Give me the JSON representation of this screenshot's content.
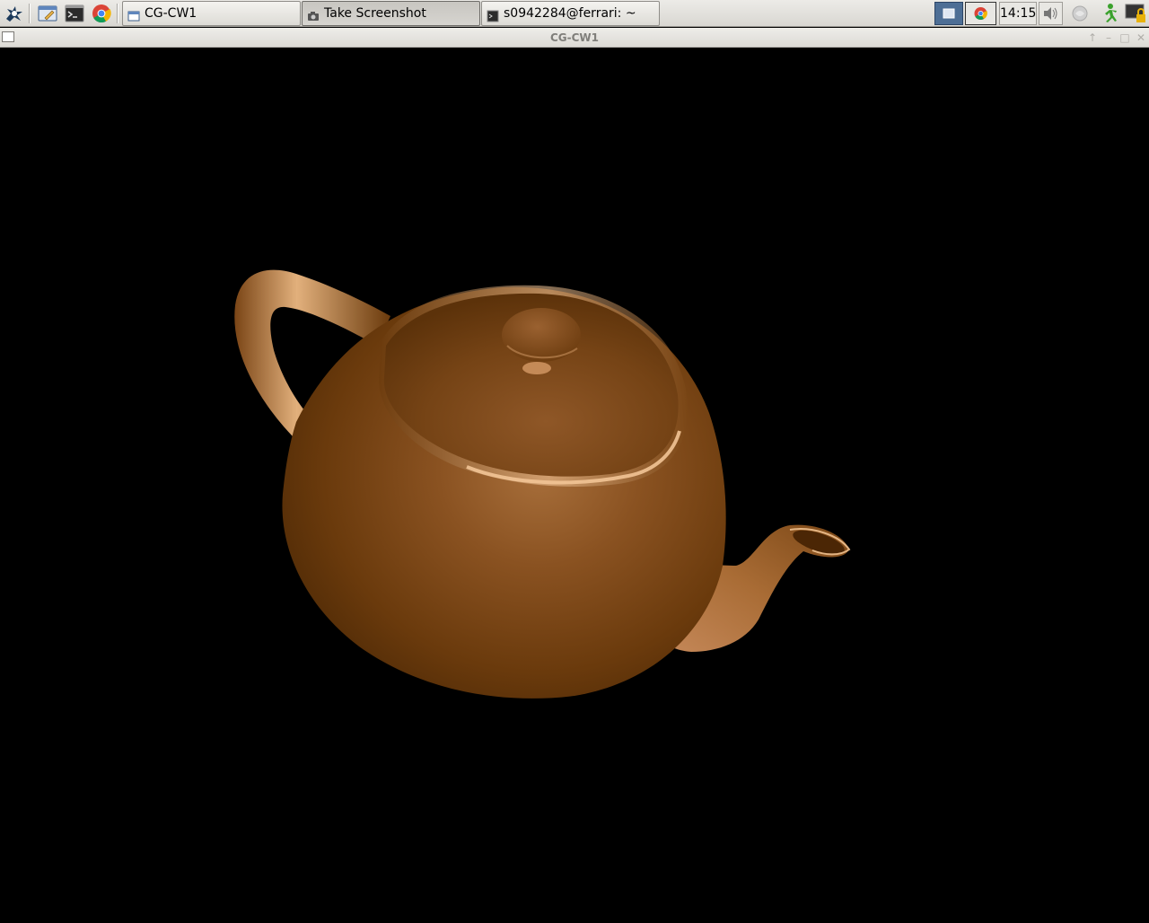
{
  "taskbar": {
    "launchers": [
      {
        "icon": "start-menu-icon"
      },
      {
        "icon": "file-manager-icon"
      },
      {
        "icon": "terminal-icon"
      },
      {
        "icon": "chrome-icon"
      }
    ],
    "tasks": [
      {
        "label": "CG-CW1",
        "icon": "window-icon",
        "active": false
      },
      {
        "label": "Take Screenshot",
        "icon": "camera-icon",
        "active": true
      },
      {
        "label": "s0942284@ferrari: ~",
        "icon": "terminal-icon",
        "active": false
      }
    ],
    "clock": "14:15",
    "tray": [
      "workspace-icon",
      "chrome-icon",
      "volume-icon",
      "network-icon",
      "runner-icon",
      "lock-screen-icon"
    ]
  },
  "window": {
    "title": "CG-CW1"
  },
  "scene": {
    "object": "teapot",
    "background_color": "#000000",
    "base_color": "#6a3a0c",
    "highlight_color": "#f3c79a"
  }
}
